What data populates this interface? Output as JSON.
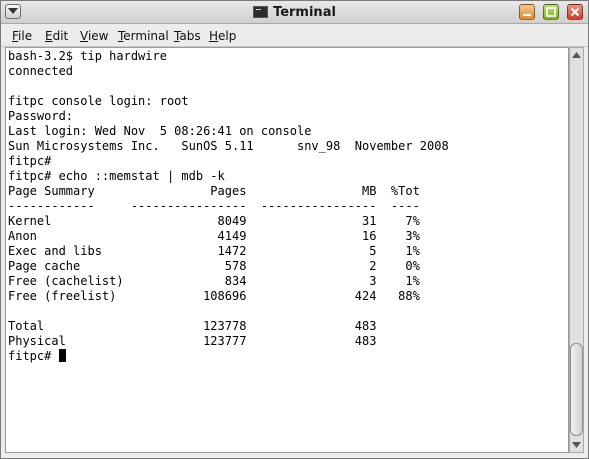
{
  "window": {
    "title": "Terminal"
  },
  "menu": {
    "items": [
      {
        "mnemonic": "F",
        "rest": "ile"
      },
      {
        "mnemonic": "E",
        "rest": "dit"
      },
      {
        "mnemonic": "V",
        "rest": "iew"
      },
      {
        "mnemonic": "T",
        "rest": "erminal"
      },
      {
        "mnemonic": "T",
        "rest": "abs"
      },
      {
        "mnemonic": "H",
        "rest": "elp"
      }
    ]
  },
  "terminal": {
    "lines": [
      "bash-3.2$ tip hardwire",
      "connected",
      "",
      "fitpc console login: root",
      "Password:",
      "Last login: Wed Nov  5 08:26:41 on console",
      "Sun Microsystems Inc.   SunOS 5.11      snv_98  November 2008",
      "fitpc#",
      "fitpc# echo ::memstat | mdb -k",
      "Page Summary                Pages                MB  %Tot",
      "------------     ----------------  ----------------  ----",
      "Kernel                       8049                31    7%",
      "Anon                         4149                16    3%",
      "Exec and libs                1472                 5    1%",
      "Page cache                    578                 2    0%",
      "Free (cachelist)              834                 3    1%",
      "Free (freelist)            108696               424   88%",
      "",
      "Total                      123778               483",
      "Physical                   123777               483"
    ],
    "prompt": "fitpc# "
  }
}
